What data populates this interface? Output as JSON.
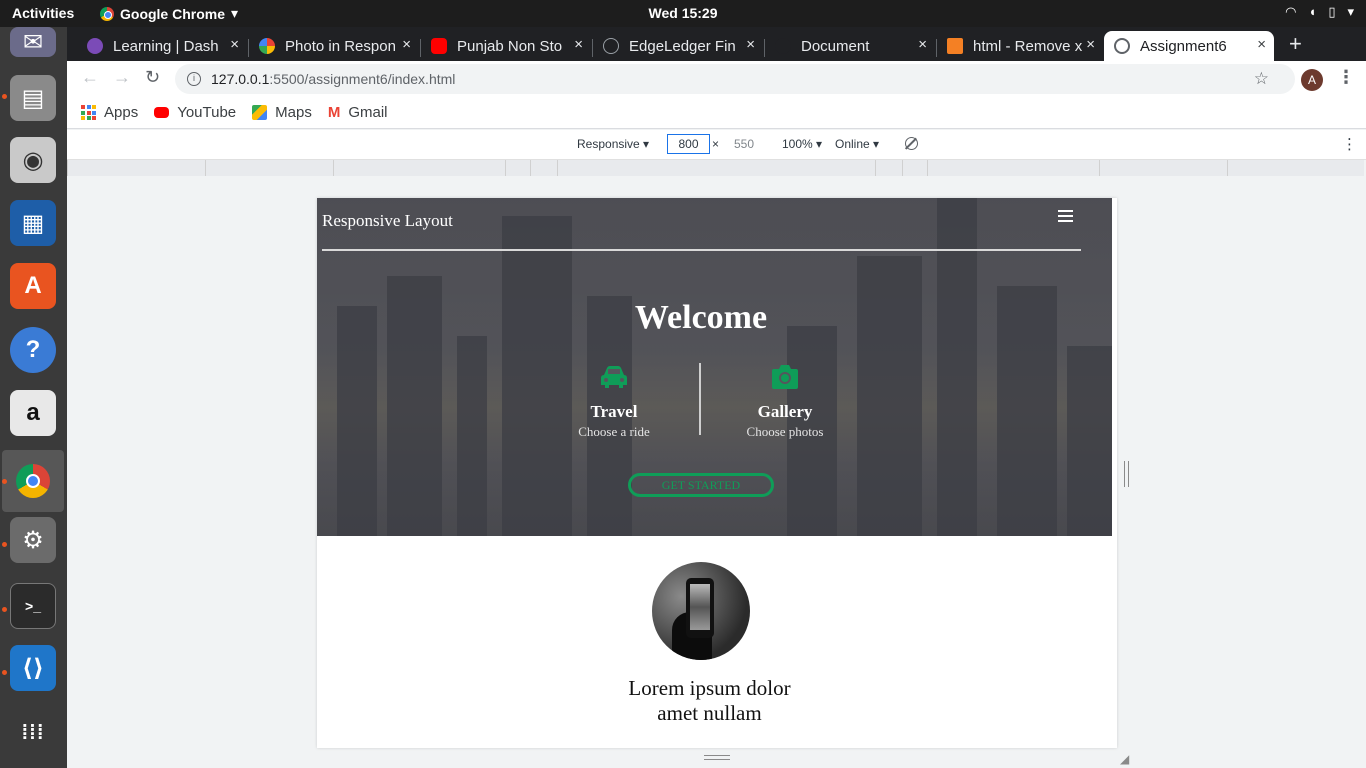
{
  "os": {
    "activities": "Activities",
    "app_name": "Google Chrome",
    "clock": "Wed 15:29",
    "tray_icons": [
      "wifi-icon",
      "volume-icon",
      "battery-icon",
      "chevron-down-icon"
    ]
  },
  "dock": {
    "items": [
      "thunderbird-icon",
      "files-icon",
      "rhythmbox-icon",
      "writer-icon",
      "software-center-icon",
      "help-icon",
      "amazon-icon",
      "chrome-icon",
      "settings-icon",
      "terminal-icon",
      "vscode-icon",
      "show-apps-icon"
    ]
  },
  "browser": {
    "tabs": [
      {
        "label": "Learning | Dash",
        "close": "×",
        "icon_color": "#7b4bb7"
      },
      {
        "label": "Photo in Respon",
        "close": "×",
        "icon_color": "#fbbc05"
      },
      {
        "label": "Punjab Non Sto",
        "close": "×",
        "icon_color": "#ff0000"
      },
      {
        "label": "EdgeLedger Fin",
        "close": "×",
        "icon_color": "#5f6368"
      },
      {
        "label": "Document",
        "close": "×",
        "icon_color": "#202124"
      },
      {
        "label": "html - Remove x",
        "close": "×",
        "icon_color": "#f48024"
      },
      {
        "label": "Assignment6",
        "close": "×",
        "icon_color": "#5f6368"
      }
    ],
    "new_tab": "+",
    "url_host": "127.0.0.1",
    "url_path": ":5500/assignment6/index.html",
    "profile_initial": "A",
    "bookmarks": [
      {
        "label": "Apps",
        "icon": "apps-grid-icon"
      },
      {
        "label": "YouTube",
        "icon": "youtube-icon"
      },
      {
        "label": "Maps",
        "icon": "maps-icon"
      },
      {
        "label": "Gmail",
        "icon": "gmail-icon"
      }
    ]
  },
  "devtools": {
    "device": "Responsive ▾",
    "width": "800",
    "times": "×",
    "height": "550",
    "zoom": "100% ▾",
    "network": "Online ▾",
    "menu": "⋮"
  },
  "site": {
    "brand": "Responsive Layout",
    "hero_title": "Welcome",
    "features": [
      {
        "title": "Travel",
        "subtitle": "Choose a ride",
        "icon": "car-icon"
      },
      {
        "title": "Gallery",
        "subtitle": "Choose photos",
        "icon": "camera-icon"
      }
    ],
    "cta": "GET STARTED",
    "accent": "#0f9d58",
    "lorem_line1": "Lorem ipsum dolor",
    "lorem_line2": "amet nullam"
  }
}
